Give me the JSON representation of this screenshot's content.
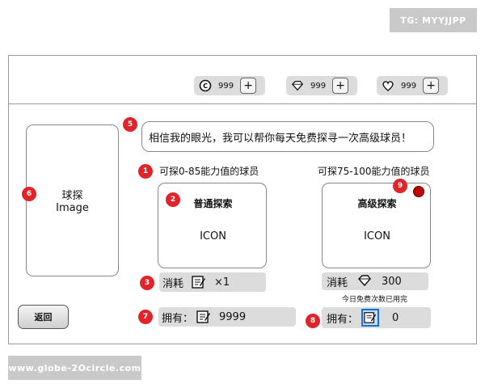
{
  "watermarks": {
    "top": "TG: MYYJJPP",
    "bottom": "www.globe-2Ocircle.com"
  },
  "resources": [
    {
      "icon": "coin-icon",
      "value": "999",
      "add": "+"
    },
    {
      "icon": "gem-icon",
      "value": "999",
      "add": "+"
    },
    {
      "icon": "heart-icon",
      "value": "999",
      "add": "+"
    }
  ],
  "scout_panel": {
    "title": "球探",
    "subtitle": "Image"
  },
  "speech": "相信我的眼光，我可以帮你每天免费探寻一次高级球员！",
  "normal": {
    "range_label": "可探0-85能力值的球员",
    "title": "普通探索",
    "icon_text": "ICON",
    "cost_label": "消耗",
    "cost_value": "×1"
  },
  "advanced": {
    "range_label": "可探75-100能力值的球员",
    "title": "高级探索",
    "icon_text": "ICON",
    "cost_label": "消耗",
    "cost_value": "300",
    "note": "今日免费次数已用完"
  },
  "owned_normal": {
    "label": "拥有：",
    "value": "9999"
  },
  "owned_advanced": {
    "label": "拥有：",
    "value": "0"
  },
  "back_label": "返回",
  "badges": {
    "b1": "1",
    "b2": "2",
    "b3": "3",
    "b5": "5",
    "b6": "6",
    "b7": "7",
    "b8": "8",
    "b9": "9"
  },
  "colors": {
    "badge": "#e0242a",
    "dot": "#c00000",
    "selection": "#1a6fd0"
  }
}
